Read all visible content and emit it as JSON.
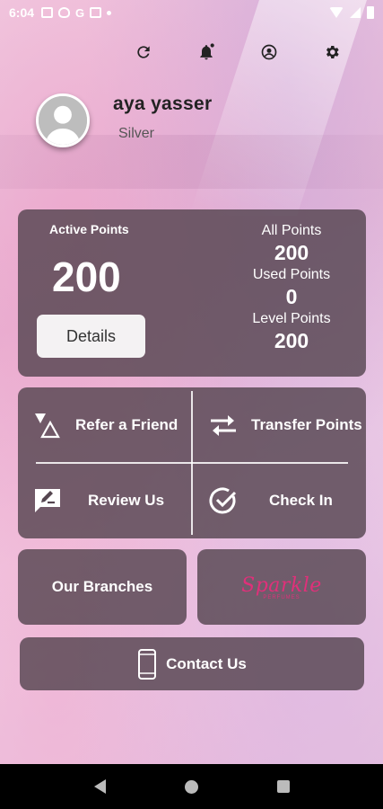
{
  "status_bar": {
    "time": "6:04",
    "g_label": "G"
  },
  "top_actions": [
    {
      "icon": "refresh-icon"
    },
    {
      "icon": "bell-icon"
    },
    {
      "icon": "account-icon"
    },
    {
      "icon": "gear-icon"
    }
  ],
  "profile": {
    "name": "aya yasser",
    "tier": "Silver"
  },
  "points": {
    "active_label": "Active Points",
    "active_value": "200",
    "details_label": "Details",
    "all_label": "All Points",
    "all_value": "200",
    "used_label": "Used Points",
    "used_value": "0",
    "level_label": "Level Points",
    "level_value": "200"
  },
  "actions": {
    "refer": "Refer a Friend",
    "transfer": "Transfer Points",
    "review": "Review Us",
    "checkin": "Check In"
  },
  "branches_label": "Our Branches",
  "brand": {
    "script": "Sparkle",
    "sub": "PERFUMES"
  },
  "contact_label": "Contact Us",
  "colors": {
    "panel": "#554650",
    "brand": "#e0307a",
    "accent_bg": "#f2cfe3"
  }
}
